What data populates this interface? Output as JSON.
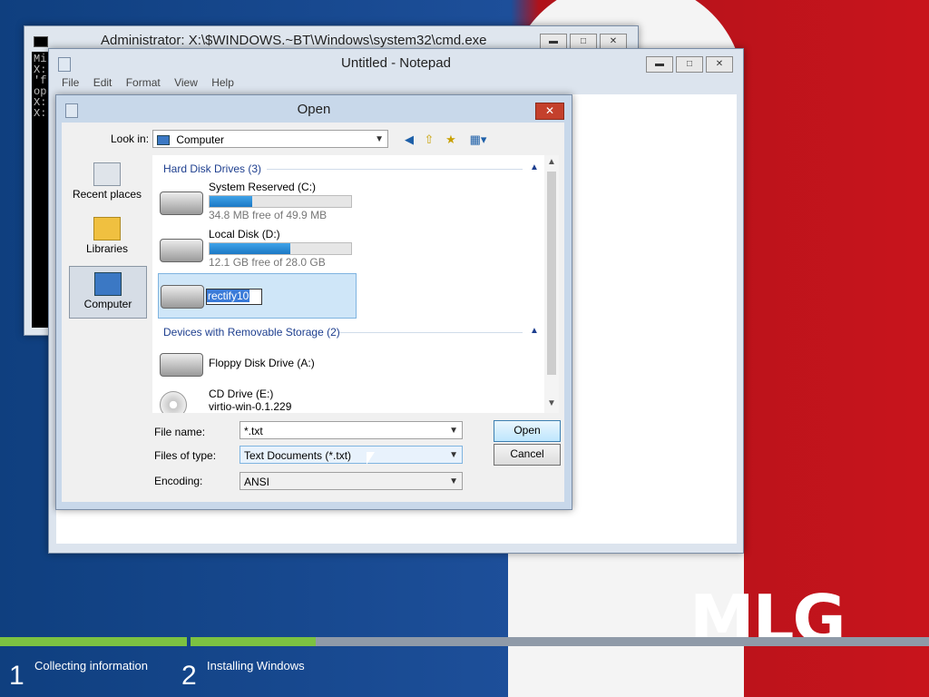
{
  "cmd": {
    "title": "Administrator: X:\\$WINDOWS.~BT\\Windows\\system32\\cmd.exe",
    "lines": [
      "Mi",
      "",
      "X:",
      "'f",
      "op",
      "",
      "X:",
      "",
      "X:"
    ]
  },
  "notepad": {
    "title": "Untitled - Notepad",
    "menu": [
      "File",
      "Edit",
      "Format",
      "View",
      "Help"
    ]
  },
  "dialog": {
    "title": "Open",
    "look_in_label": "Look in:",
    "look_in_value": "Computer",
    "places": [
      {
        "label": "Recent places",
        "selected": false
      },
      {
        "label": "Libraries",
        "selected": false
      },
      {
        "label": "Computer",
        "selected": true
      }
    ],
    "groups": {
      "hard_disks": "Hard Disk Drives (3)",
      "removable": "Devices with Removable Storage (2)"
    },
    "drives": [
      {
        "name": "System Reserved (C:)",
        "free": "34.8 MB free of 49.9 MB",
        "used_fraction": 0.3
      },
      {
        "name": "Local Disk (D:)",
        "free": "12.1 GB free of 28.0 GB",
        "used_fraction": 0.57
      },
      {
        "name": "rectify10",
        "renaming": true
      }
    ],
    "removable": [
      {
        "name": "Floppy Disk Drive (A:)"
      },
      {
        "name": "CD Drive (E:)",
        "sub": "virtio-win-0.1.229"
      }
    ],
    "file_name_label": "File name:",
    "file_name_value": "*.txt",
    "file_type_label": "Files of type:",
    "file_type_value": "Text Documents (*.txt)",
    "encoding_label": "Encoding:",
    "encoding_value": "ANSI",
    "open_button": "Open",
    "cancel_button": "Cancel"
  },
  "setup": {
    "step1_num": "1",
    "step1_label": "Collecting information",
    "step1_progress": 1.0,
    "step2_num": "2",
    "step2_label": "Installing Windows",
    "step2_progress": 0.17
  },
  "background": {
    "logo": "MLG"
  }
}
